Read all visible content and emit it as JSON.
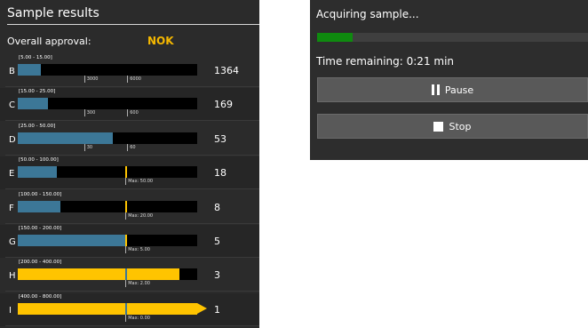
{
  "results": {
    "title": "Sample results",
    "approval_label": "Overall approval:",
    "approval_value": "NOK",
    "rows": [
      {
        "letter": "B",
        "range": "[5.00 - 15.00]",
        "count": "1364",
        "fill": 0.13,
        "color": "#3c7797",
        "ticks": [
          "3000",
          "6000"
        ],
        "max": null,
        "limit": null
      },
      {
        "letter": "C",
        "range": "[15.00 - 25.00]",
        "count": "169",
        "fill": 0.17,
        "color": "#3c7797",
        "ticks": [
          "300",
          "600"
        ],
        "max": null,
        "limit": null
      },
      {
        "letter": "D",
        "range": "[25.00 - 50.00]",
        "count": "53",
        "fill": 0.53,
        "color": "#3c7797",
        "ticks": [
          "30",
          "60"
        ],
        "max": null,
        "limit": null
      },
      {
        "letter": "E",
        "range": "[50.00 - 100.00]",
        "count": "18",
        "fill": 0.22,
        "color": "#3c7797",
        "ticks": [],
        "max": "Max: 50.00",
        "limit": 0.6,
        "limit_color": "#ffc400"
      },
      {
        "letter": "F",
        "range": "[100.00 - 150.00]",
        "count": "8",
        "fill": 0.24,
        "color": "#3c7797",
        "ticks": [],
        "max": "Max: 20.00",
        "limit": 0.6,
        "limit_color": "#ffc400"
      },
      {
        "letter": "G",
        "range": "[150.00 - 200.00]",
        "count": "5",
        "fill": 0.6,
        "color": "#3c7797",
        "ticks": [],
        "max": "Max: 5.00",
        "limit": 0.6,
        "limit_color": "#ffc400"
      },
      {
        "letter": "H",
        "range": "[200.00 - 400.00]",
        "count": "3",
        "fill": 0.9,
        "color": "#ffc400",
        "ticks": [],
        "max": "Max: 2.00",
        "limit": 0.6,
        "limit_color": "#3c7797"
      },
      {
        "letter": "I",
        "range": "[400.00 - 800.00]",
        "count": "1",
        "fill": 1.0,
        "color": "#ffc400",
        "ticks": [],
        "max": "Max: 0.00",
        "limit": 0.6,
        "limit_color": "#3c7797",
        "overflow": true
      }
    ]
  },
  "acquisition": {
    "title": "Acquiring sample...",
    "progress": 0.13,
    "time_remaining": "Time remaining: 0:21 min",
    "pause_label": "Pause",
    "stop_label": "Stop"
  },
  "icons": {
    "pause": "pause-icon",
    "stop": "stop-icon"
  },
  "colors": {
    "accent": "#ffc400",
    "bar": "#3c7797",
    "progress": "#0f8a0f"
  }
}
